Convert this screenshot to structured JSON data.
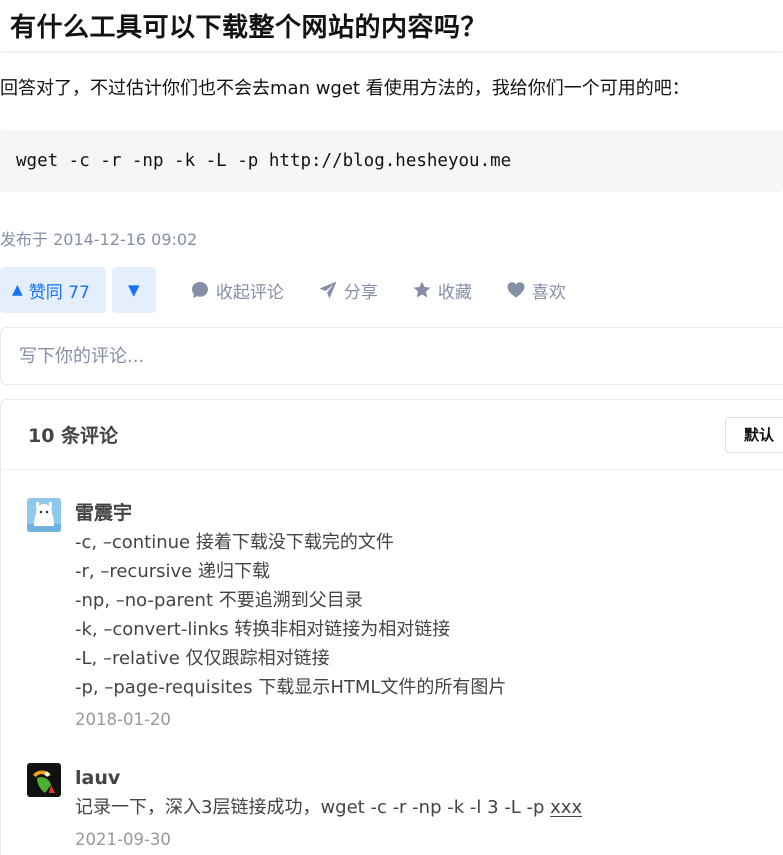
{
  "question": {
    "title": "有什么工具可以下载整个网站的内容吗？"
  },
  "answer": {
    "text": "回答对了，不过估计你们也不会去man wget 看使用方法的，我给你们一个可用的吧：",
    "code": "wget -c -r -np -k -L -p http://blog.hesheyou.me",
    "published": "发布于 2014-12-16 09:02"
  },
  "actions": {
    "vote_up_label": "赞同 77",
    "collapse_comments": "收起评论",
    "share": "分享",
    "favorite": "收藏",
    "like": "喜欢"
  },
  "comment_box": {
    "placeholder": "写下你的评论..."
  },
  "comments": {
    "count_label": "10 条评论",
    "sort_label": "默认",
    "items": [
      {
        "author": "雷震宇",
        "lines": [
          "-c, –continue 接着下载没下载完的文件",
          "-r, –recursive 递归下载",
          "-np, –no-parent 不要追溯到父目录",
          "-k, –convert-links 转换非相对链接为相对链接",
          "-L, –relative 仅仅跟踪相对链接",
          "-p, –page-requisites 下载显示HTML文件的所有图片"
        ],
        "date": "2018-01-20"
      },
      {
        "author": "lauv",
        "text_prefix": "记录一下，深入3层链接成功，wget -c -r -np -k -l 3 -L -p ",
        "text_link": "xxx",
        "date": "2021-09-30"
      }
    ]
  },
  "colors": {
    "accent": "#1772f6",
    "accent_bg": "#e5eefc",
    "muted": "#8590a6",
    "code_bg": "#f6f6f6"
  }
}
